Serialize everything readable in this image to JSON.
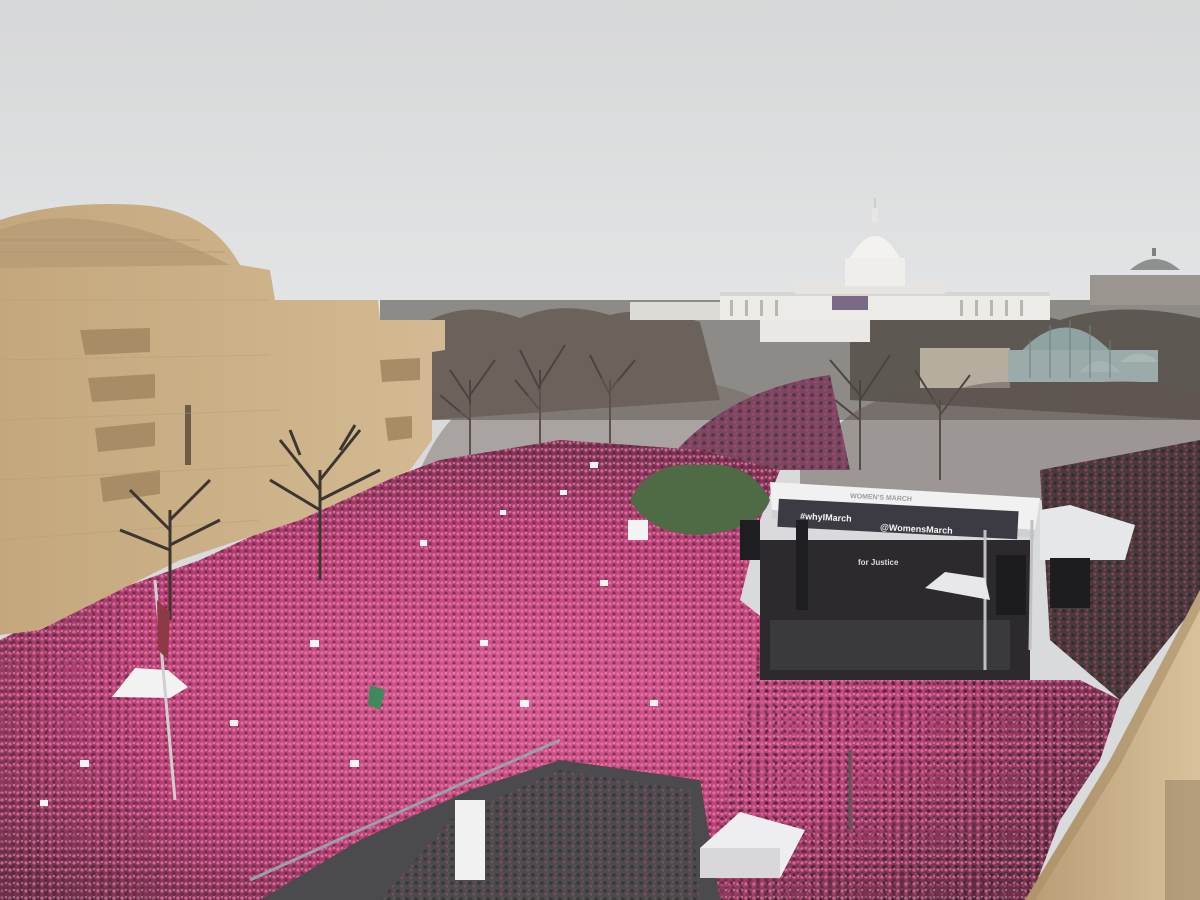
{
  "photo": {
    "stage_banner_top": "WOMEN'S MARCH",
    "stage_banner_left": "#whyIMarch",
    "stage_banner_right": "@WomensMarch",
    "stage_banner_lower": "for Justice"
  },
  "colors": {
    "sky": "#dedfe0",
    "museum_stone": "#c9ae84",
    "crowd_pink": "#d24a86",
    "crowd_dark": "#3a2530",
    "capitol_white": "#eceae6",
    "trees": "#5a5048",
    "stage_roof": "#f2f2f2",
    "road": "#4a4a4c"
  }
}
